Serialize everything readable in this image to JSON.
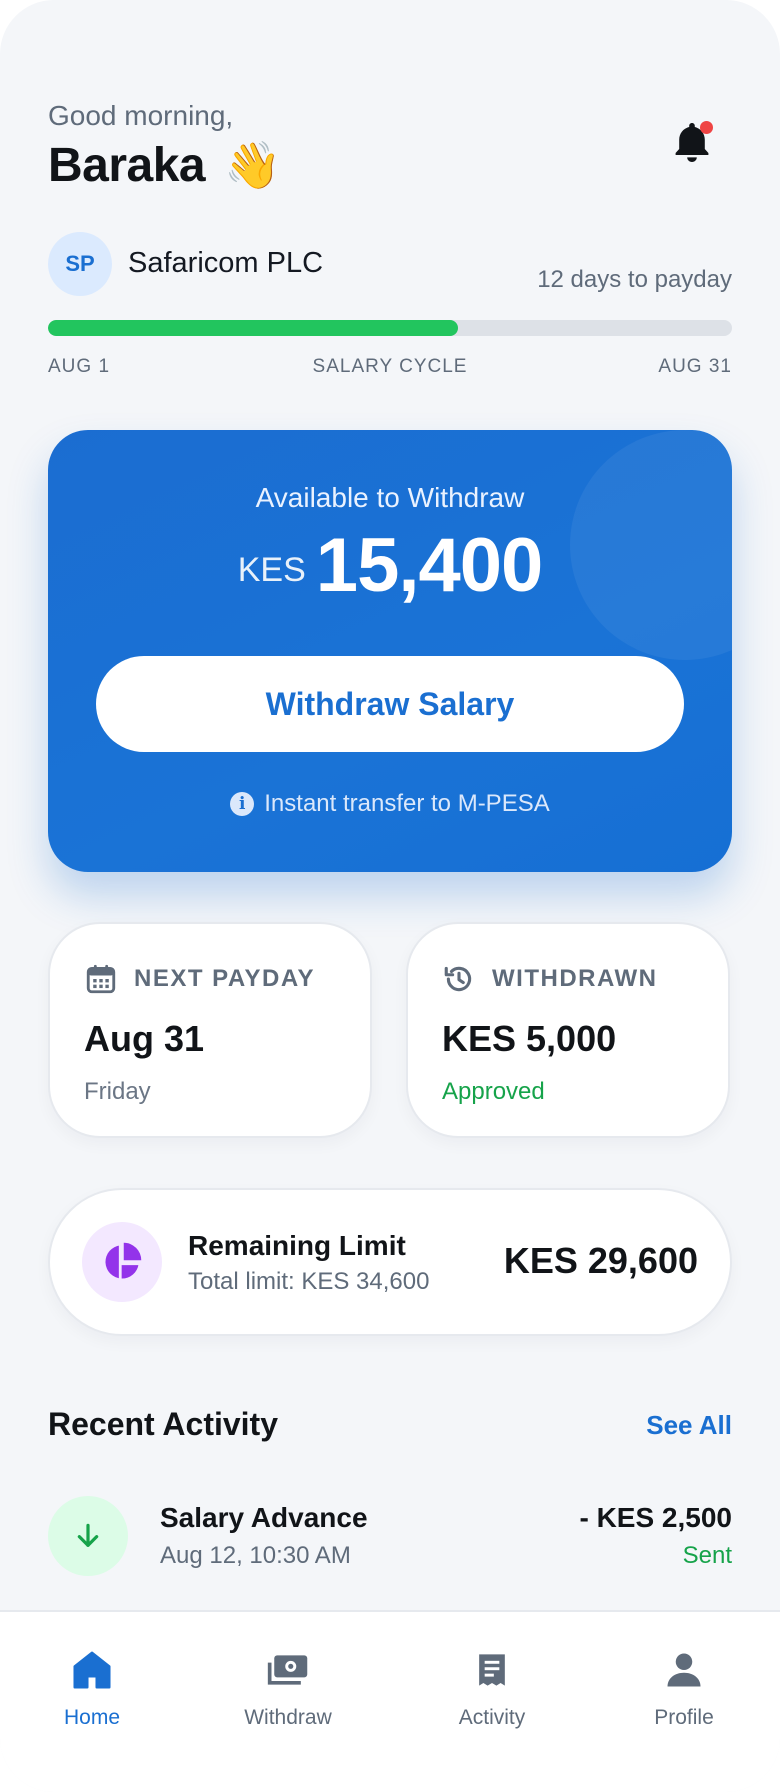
{
  "header": {
    "greeting": "Good morning,",
    "name": "Baraka",
    "wave_emoji": "👋",
    "notification_icon": "bell-icon",
    "has_unread": true
  },
  "employer": {
    "initials": "SP",
    "name": "Safaricom PLC",
    "payday_countdown": "12 days to payday",
    "cycle_progress": 0.6,
    "cycle_start": "AUG 1",
    "cycle_label": "SALARY CYCLE",
    "cycle_end": "AUG 31"
  },
  "balance": {
    "label": "Available to Withdraw",
    "currency": "KES",
    "amount": "15,400",
    "button_label": "Withdraw Salary",
    "note": "Instant transfer to M-PESA",
    "note_icon": "info-icon"
  },
  "stats": {
    "next_payday": {
      "icon": "calendar-icon",
      "title": "NEXT PAYDAY",
      "value": "Aug 31",
      "sub": "Friday"
    },
    "withdrawn": {
      "icon": "history-icon",
      "title": "WITHDRAWN",
      "value": "KES 5,000",
      "sub": "Approved"
    }
  },
  "limit": {
    "icon": "pie-chart-icon",
    "title": "Remaining Limit",
    "sub": "Total limit: KES 34,600",
    "value": "KES 29,600"
  },
  "activity": {
    "title": "Recent Activity",
    "see_all": "See All",
    "items": [
      {
        "icon": "arrow-down-icon",
        "title": "Salary Advance",
        "time": "Aug 12, 10:30 AM",
        "amount": "- KES 2,500",
        "status": "Sent"
      }
    ]
  },
  "nav": {
    "items": [
      {
        "icon": "home-icon",
        "label": "Home",
        "active": true
      },
      {
        "icon": "cash-icon",
        "label": "Withdraw",
        "active": false
      },
      {
        "icon": "receipt-icon",
        "label": "Activity",
        "active": false
      },
      {
        "icon": "person-icon",
        "label": "Profile",
        "active": false
      }
    ]
  },
  "colors": {
    "primary": "#1a6fd1",
    "progress": "#22c55e",
    "success": "#16a34a",
    "alert_dot": "#ef4444",
    "limit_accent": "#9333ea"
  }
}
